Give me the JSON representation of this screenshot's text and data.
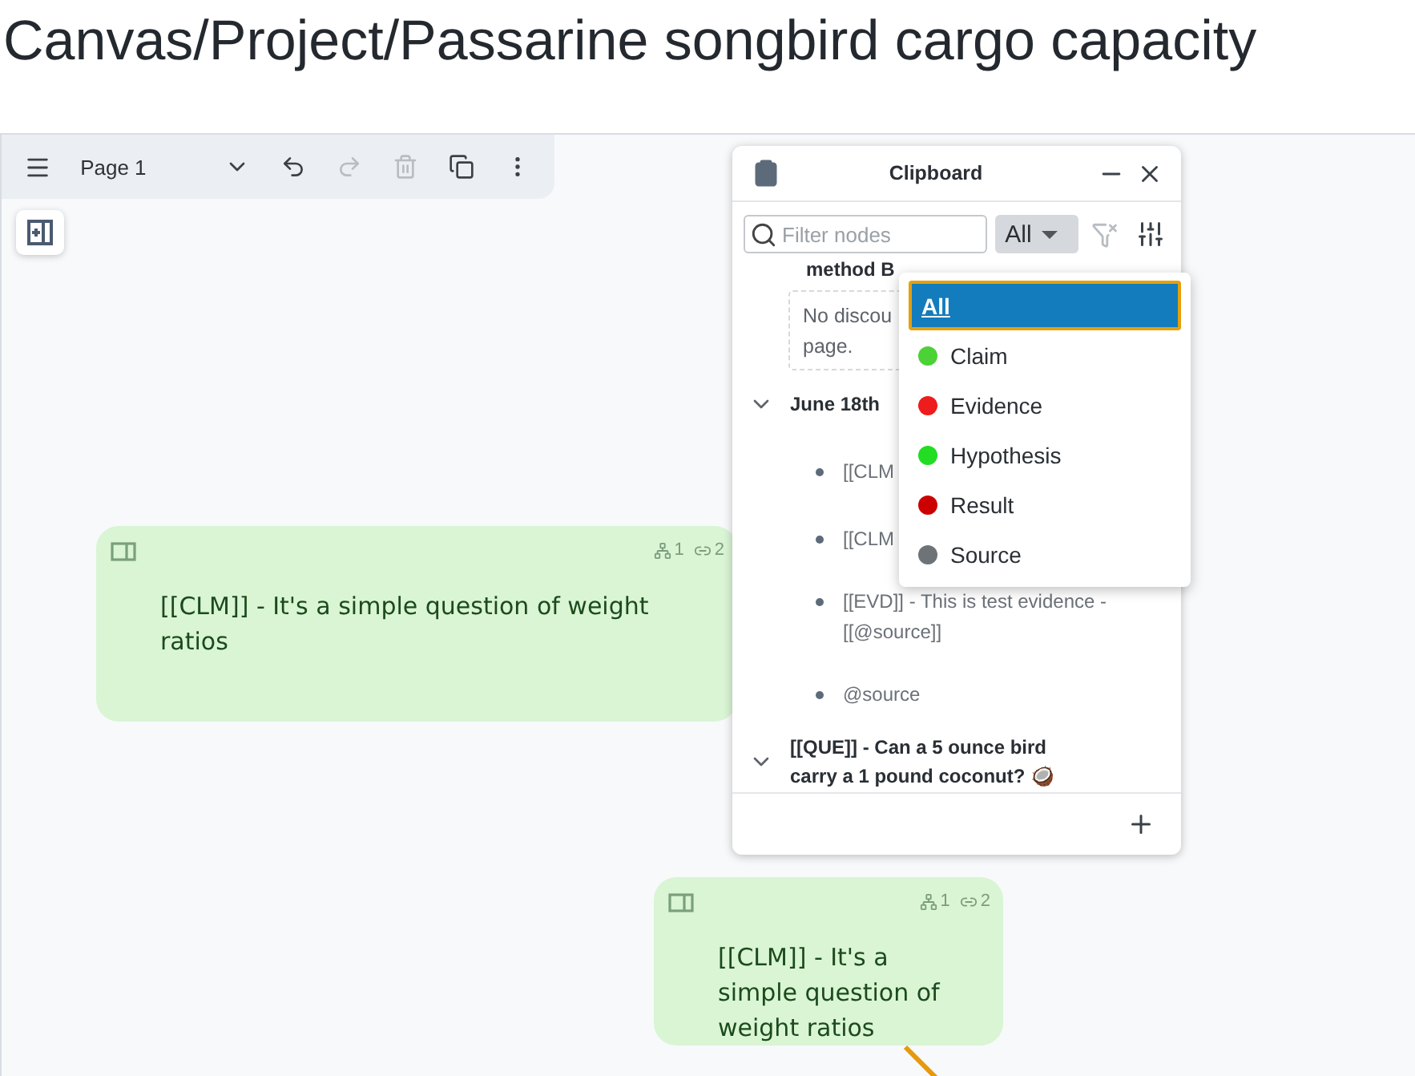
{
  "title": "Canvas/Project/Passarine songbird cargo capacity",
  "toolbar": {
    "page_label": "Page 1",
    "buttons": [
      {
        "kind": "undo",
        "disabled": false
      },
      {
        "kind": "redo",
        "disabled": true
      },
      {
        "kind": "delete",
        "disabled": true
      },
      {
        "kind": "duplicate",
        "disabled": false
      },
      {
        "kind": "more",
        "disabled": false
      }
    ]
  },
  "clipboard": {
    "title": "Clipboard",
    "filter_placeholder": "Filter nodes",
    "type_filter": "All",
    "items": [
      {
        "kind": "title",
        "text": "method B"
      },
      {
        "kind": "empty",
        "lines": [
          "No discou",
          "page."
        ]
      },
      {
        "kind": "group",
        "text": "June 18th",
        "expanded": true,
        "children": [
          {
            "text": "[[CLM"
          },
          {
            "text": "[[CLM"
          },
          {
            "text": "[[EVD]] - This is test evidence - [[@source]]"
          },
          {
            "text": "@source"
          }
        ]
      },
      {
        "kind": "group",
        "text": "[[QUE]] - Can a 5 ounce bird carry a 1 pound coconut? 🥥",
        "expanded": true
      }
    ],
    "dropdown": [
      {
        "label": "All",
        "selected": true
      },
      {
        "label": "Claim",
        "color": "#4cd137",
        "selected": false
      },
      {
        "label": "Evidence",
        "color": "#ee1c1c",
        "selected": false
      },
      {
        "label": "Hypothesis",
        "color": "#22dd22",
        "selected": false
      },
      {
        "label": "Result",
        "color": "#cc0000",
        "selected": false
      },
      {
        "label": "Source",
        "color": "#6e7378",
        "selected": false
      }
    ]
  },
  "nodes": [
    {
      "text": "[[CLM]] - It's a simple question of weight ratios",
      "children_count": "1",
      "links_count": "2"
    },
    {
      "text": "[[CLM]] - It's a simple question of weight ratios",
      "children_count": "1",
      "links_count": "2"
    }
  ]
}
